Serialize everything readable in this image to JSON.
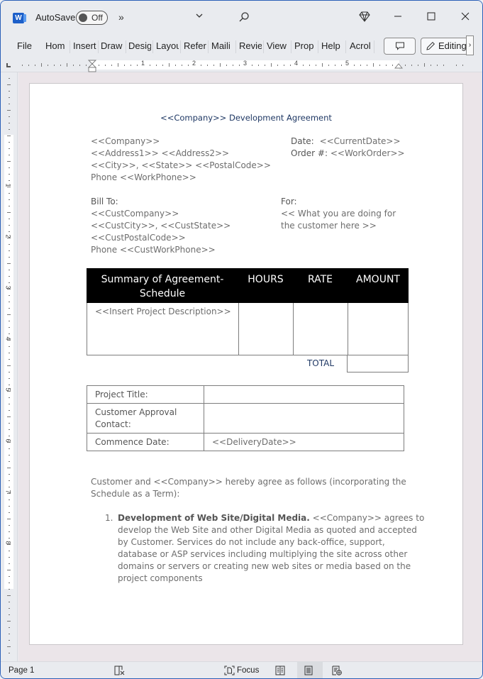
{
  "titlebar": {
    "app_icon": "word-logo-icon",
    "autosave_label": "AutoSave",
    "autosave_state": "Off",
    "more_commands": "»",
    "customize_icon": "chevron-down-icon",
    "search_icon": "search-icon",
    "premium_icon": "diamond-icon",
    "minimize": "—",
    "maximize": "☐",
    "close": "✕"
  },
  "ribbon": {
    "tabs": [
      "File",
      "Home",
      "Insert",
      "Draw",
      "Design",
      "Layout",
      "References",
      "Mailings",
      "Review",
      "View",
      "Properties",
      "Help",
      "Acrobat"
    ],
    "tabs_visible": [
      "File",
      "Hom",
      "Insert",
      "Draw",
      "Desig",
      "Layou",
      "Refer",
      "Maili",
      "Revie",
      "View",
      "Prop",
      "Help",
      "Acrol"
    ],
    "comment_icon": "comment-icon",
    "editing_label": "Editing",
    "editing_icon": "pencil-icon",
    "more_icon": "chevron-right-icon"
  },
  "ruler": {
    "h_numbers": [
      "1",
      "2",
      "3",
      "4",
      "5"
    ],
    "v_numbers": [
      "1",
      "2",
      "3",
      "4",
      "5",
      "6",
      "7",
      "8"
    ]
  },
  "document": {
    "title": "<<Company>> Development Agreement",
    "from_lines": [
      "<<Company>>",
      "<<Address1>> <<Address2>>",
      "<<City>>, <<State>> <<PostalCode>>",
      "Phone <<WorkPhone>>"
    ],
    "date_label": "Date:",
    "date_value": "<<CurrentDate>>",
    "order_label": "Order #:",
    "order_value": "<<WorkOrder>>",
    "bill_to_label": "Bill To:",
    "bill_to_lines": [
      "<<CustCompany>>",
      "<<CustCity>>, <<CustState>>",
      "<<CustPostalCode>>",
      "Phone <<CustWorkPhone>>"
    ],
    "for_label": "For:",
    "for_lines": [
      "<< What you are doing for",
      "the customer here >>"
    ],
    "summary_table": {
      "headers": [
        "Summary of Agreement-",
        "Schedule",
        "HOURS",
        "RATE",
        "AMOUNT"
      ],
      "row_description": "<<Insert Project Description>>",
      "hours": "",
      "rate": "",
      "amount": "",
      "total_label": "TOTAL",
      "total_value": ""
    },
    "project_table": {
      "rows": [
        {
          "label": "Project Title:",
          "value": ""
        },
        {
          "label": "Customer Approval",
          "label2": "Contact:",
          "value": ""
        },
        {
          "label": "Commence Date:",
          "value": "<<DeliveryDate>>"
        }
      ]
    },
    "intro_lines": [
      "Customer and <<Company>> hereby agree as follows (incorporating the",
      "Schedule as a Term):"
    ],
    "clause": {
      "number": "1.",
      "heading": "Development of Web Site/Digital Media.",
      "first_line_rest": " <<Company>> agrees to",
      "lines": [
        "develop the Web Site and other Digital Media as quoted and accepted",
        "by Customer.  Services do not include any back-office, support,",
        "database or ASP services including multiplying the site across other",
        "domains or servers or creating new web sites or media based on the",
        "project components"
      ]
    }
  },
  "statusbar": {
    "page": "Page 1",
    "proofing_icon": "proofing-icon",
    "focus_label": "Focus",
    "focus_icon": "focus-icon",
    "read_mode_icon": "read-mode-icon",
    "print_layout_icon": "print-layout-icon",
    "web_layout_icon": "web-layout-icon"
  },
  "colors": {
    "accent": "#2b5fb8",
    "title_blue": "#1f3864",
    "table_header": "#000000",
    "body_text": "#6d6d6d"
  }
}
